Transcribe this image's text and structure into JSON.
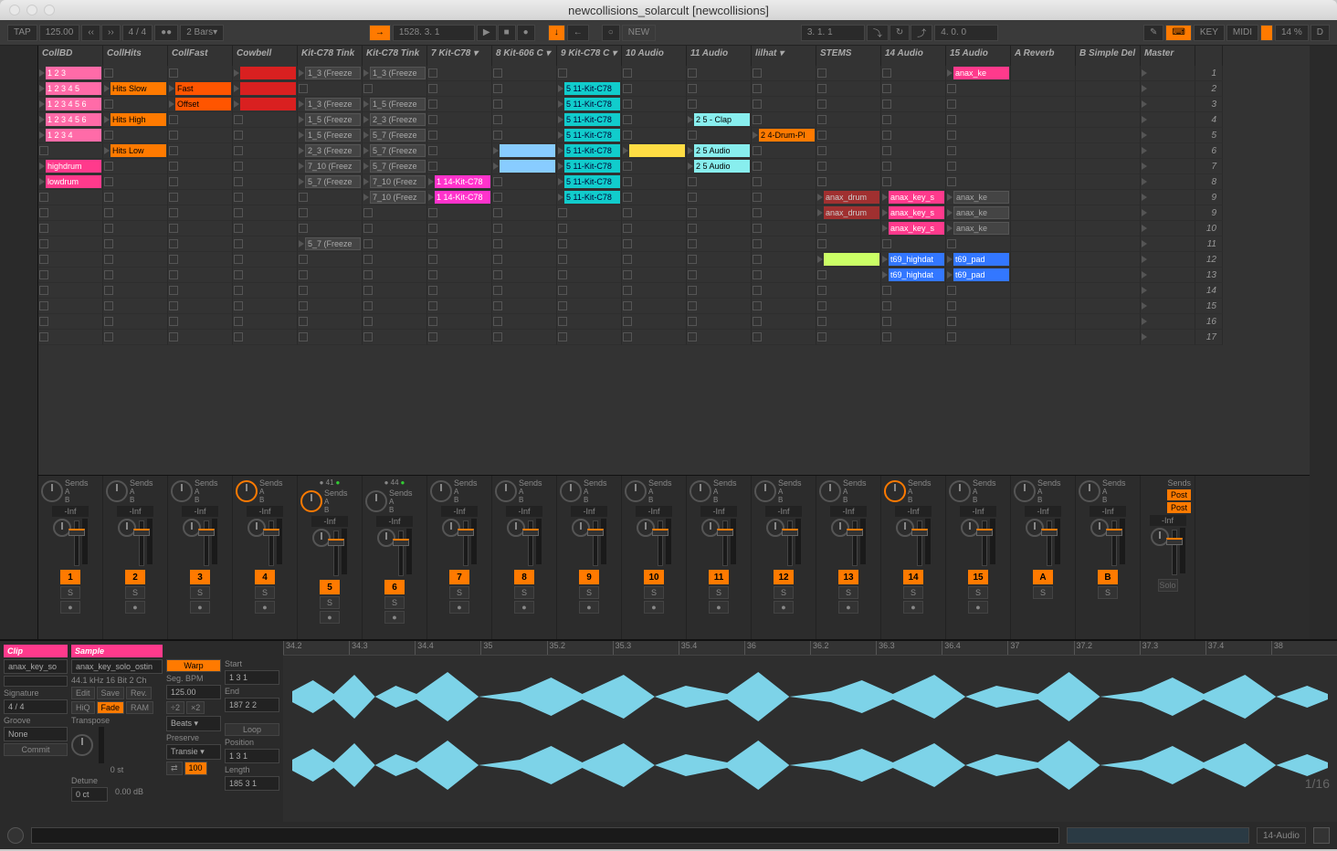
{
  "window": {
    "title": "newcollisions_solarcult  [newcollisions]"
  },
  "toolbar": {
    "tap": "TAP",
    "tempo": "125.00",
    "sig": "4 / 4",
    "quantize": "2 Bars",
    "position": "1528. 3. 1",
    "loop_pos": "3. 1. 1",
    "loop_len": "4. 0. 0",
    "key": "KEY",
    "midi": "MIDI",
    "cpu": "14 %",
    "d": "D",
    "new": "NEW"
  },
  "tracks": [
    "CollBD",
    "CollHits",
    "CollFast",
    "Cowbell",
    "Kit-C78 Tink",
    "Kit-C78 Tink",
    "7 Kit-C78",
    "8 Kit-606 C",
    "9 Kit-C78 C",
    "10 Audio",
    "11 Audio",
    "lilhat",
    "STEMS",
    "14 Audio",
    "15 Audio",
    "A Reverb",
    "B Simple Del",
    "Master"
  ],
  "scenes": [
    "1",
    "2",
    "3",
    "4",
    "5",
    "6",
    "7",
    "8",
    "9",
    "9",
    "10",
    "11",
    "12",
    "13",
    "14",
    "15",
    "16",
    "17"
  ],
  "grid": [
    [
      {
        "c": "c-pink",
        "t": "1 2 3"
      },
      {
        "c": "stop"
      },
      {
        "c": "stop"
      },
      {
        "c": "c-red",
        "t": ""
      },
      {
        "c": "c-grey",
        "t": "1_3 (Freeze"
      },
      {
        "c": "c-grey",
        "t": "1_3 (Freeze"
      },
      {
        "c": "stop"
      },
      {
        "c": "stop"
      },
      {
        "c": "stop"
      },
      {
        "c": "stop"
      },
      {
        "c": "stop"
      },
      {
        "c": "stop"
      },
      {
        "c": "stop"
      },
      {
        "c": "stop"
      },
      {
        "c": "c-dpink",
        "t": "anax_ke"
      },
      {
        "c": ""
      },
      {
        "c": ""
      }
    ],
    [
      {
        "c": "c-pink",
        "t": "1 2 3 4 5"
      },
      {
        "c": "c-orange",
        "t": "Hits Slow"
      },
      {
        "c": "c-dorange",
        "t": "Fast"
      },
      {
        "c": "c-red",
        "t": ""
      },
      {
        "c": "stop"
      },
      {
        "c": "stop"
      },
      {
        "c": "stop"
      },
      {
        "c": "stop"
      },
      {
        "c": "c-cyan",
        "t": "5 11-Kit-C78"
      },
      {
        "c": "stop"
      },
      {
        "c": "stop"
      },
      {
        "c": "stop"
      },
      {
        "c": "stop"
      },
      {
        "c": "stop"
      },
      {
        "c": "stop"
      },
      {
        "c": ""
      },
      {
        "c": ""
      }
    ],
    [
      {
        "c": "c-pink",
        "t": "1 2 3 4 5 6"
      },
      {
        "c": "stop"
      },
      {
        "c": "c-dorange",
        "t": "Offset"
      },
      {
        "c": "c-red",
        "t": ""
      },
      {
        "c": "c-grey",
        "t": "1_3 (Freeze"
      },
      {
        "c": "c-grey",
        "t": "1_5 (Freeze"
      },
      {
        "c": "stop"
      },
      {
        "c": "stop"
      },
      {
        "c": "c-cyan",
        "t": "5 11-Kit-C78"
      },
      {
        "c": "stop"
      },
      {
        "c": "stop"
      },
      {
        "c": "stop"
      },
      {
        "c": "stop"
      },
      {
        "c": "stop"
      },
      {
        "c": "stop"
      },
      {
        "c": ""
      },
      {
        "c": ""
      }
    ],
    [
      {
        "c": "c-pink",
        "t": "1 2 3 4 5 6"
      },
      {
        "c": "c-orange",
        "t": "Hits High"
      },
      {
        "c": "stop"
      },
      {
        "c": "stop"
      },
      {
        "c": "c-grey",
        "t": "1_5 (Freeze"
      },
      {
        "c": "c-grey",
        "t": "2_3 (Freeze"
      },
      {
        "c": "stop"
      },
      {
        "c": "stop"
      },
      {
        "c": "c-cyan",
        "t": "5 11-Kit-C78"
      },
      {
        "c": "stop"
      },
      {
        "c": "c-lcyan",
        "t": "2 5 - Clap"
      },
      {
        "c": "stop"
      },
      {
        "c": "stop"
      },
      {
        "c": "stop"
      },
      {
        "c": "stop"
      },
      {
        "c": ""
      },
      {
        "c": ""
      }
    ],
    [
      {
        "c": "c-pink",
        "t": "1 2 3 4"
      },
      {
        "c": "stop"
      },
      {
        "c": "stop"
      },
      {
        "c": "stop"
      },
      {
        "c": "c-grey",
        "t": "1_5 (Freeze"
      },
      {
        "c": "c-grey",
        "t": "5_7 (Freeze"
      },
      {
        "c": "stop"
      },
      {
        "c": "stop"
      },
      {
        "c": "c-cyan",
        "t": "5 11-Kit-C78"
      },
      {
        "c": "stop"
      },
      {
        "c": "stop"
      },
      {
        "c": "c-orange",
        "t": "2 4-Drum-Pl"
      },
      {
        "c": "stop"
      },
      {
        "c": "stop"
      },
      {
        "c": "stop"
      },
      {
        "c": ""
      },
      {
        "c": ""
      }
    ],
    [
      {
        "c": "stop"
      },
      {
        "c": "c-orange",
        "t": "Hits Low"
      },
      {
        "c": "stop"
      },
      {
        "c": "stop"
      },
      {
        "c": "c-grey",
        "t": "2_3 (Freeze"
      },
      {
        "c": "c-grey",
        "t": "5_7 (Freeze"
      },
      {
        "c": "stop"
      },
      {
        "c": "c-lblue",
        "t": ""
      },
      {
        "c": "c-cyan",
        "t": "5 11-Kit-C78"
      },
      {
        "c": "c-yellow",
        "t": ""
      },
      {
        "c": "c-lcyan",
        "t": "2 5 Audio"
      },
      {
        "c": "stop"
      },
      {
        "c": "stop"
      },
      {
        "c": "stop"
      },
      {
        "c": "stop"
      },
      {
        "c": ""
      },
      {
        "c": ""
      }
    ],
    [
      {
        "c": "c-dpink",
        "t": "highdrum"
      },
      {
        "c": "stop"
      },
      {
        "c": "stop"
      },
      {
        "c": "stop"
      },
      {
        "c": "c-grey",
        "t": "7_10 (Freez"
      },
      {
        "c": "c-grey",
        "t": "5_7 (Freeze"
      },
      {
        "c": "stop"
      },
      {
        "c": "c-lblue",
        "t": ""
      },
      {
        "c": "c-cyan",
        "t": "5 11-Kit-C78"
      },
      {
        "c": "stop"
      },
      {
        "c": "c-lcyan",
        "t": "2 5 Audio"
      },
      {
        "c": "stop"
      },
      {
        "c": "stop"
      },
      {
        "c": "stop"
      },
      {
        "c": "stop"
      },
      {
        "c": ""
      },
      {
        "c": ""
      }
    ],
    [
      {
        "c": "c-dpink",
        "t": "lowdrum"
      },
      {
        "c": "stop"
      },
      {
        "c": "stop"
      },
      {
        "c": "stop"
      },
      {
        "c": "c-grey",
        "t": "5_7 (Freeze"
      },
      {
        "c": "c-grey",
        "t": "7_10 (Freez"
      },
      {
        "c": "c-magenta",
        "t": "1 14-Kit-C78"
      },
      {
        "c": "stop"
      },
      {
        "c": "c-cyan",
        "t": "5 11-Kit-C78"
      },
      {
        "c": "stop"
      },
      {
        "c": "stop"
      },
      {
        "c": "stop"
      },
      {
        "c": "stop"
      },
      {
        "c": "stop"
      },
      {
        "c": "stop"
      },
      {
        "c": ""
      },
      {
        "c": ""
      }
    ],
    [
      {
        "c": "stop"
      },
      {
        "c": "stop"
      },
      {
        "c": "stop"
      },
      {
        "c": "stop"
      },
      {
        "c": "stop"
      },
      {
        "c": "c-grey",
        "t": "7_10 (Freez"
      },
      {
        "c": "c-magenta",
        "t": "1 14-Kit-C78"
      },
      {
        "c": "stop"
      },
      {
        "c": "c-cyan",
        "t": "5 11-Kit-C78"
      },
      {
        "c": "stop"
      },
      {
        "c": "stop"
      },
      {
        "c": "stop"
      },
      {
        "c": "c-dred",
        "t": "anax_drum"
      },
      {
        "c": "c-dpink",
        "t": "anax_key_s"
      },
      {
        "c": "c-grey",
        "t": "anax_ke"
      },
      {
        "c": ""
      },
      {
        "c": ""
      }
    ],
    [
      {
        "c": "stop"
      },
      {
        "c": "stop"
      },
      {
        "c": "stop"
      },
      {
        "c": "stop"
      },
      {
        "c": "stop"
      },
      {
        "c": "stop"
      },
      {
        "c": "stop"
      },
      {
        "c": "stop"
      },
      {
        "c": "stop"
      },
      {
        "c": "stop"
      },
      {
        "c": "stop"
      },
      {
        "c": "stop"
      },
      {
        "c": "c-dred",
        "t": "anax_drum"
      },
      {
        "c": "c-dpink",
        "t": "anax_key_s"
      },
      {
        "c": "c-grey",
        "t": "anax_ke"
      },
      {
        "c": ""
      },
      {
        "c": ""
      }
    ],
    [
      {
        "c": "stop"
      },
      {
        "c": "stop"
      },
      {
        "c": "stop"
      },
      {
        "c": "stop"
      },
      {
        "c": "stop"
      },
      {
        "c": "stop"
      },
      {
        "c": "stop"
      },
      {
        "c": "stop"
      },
      {
        "c": "stop"
      },
      {
        "c": "stop"
      },
      {
        "c": "stop"
      },
      {
        "c": "stop"
      },
      {
        "c": "stop"
      },
      {
        "c": "c-dpink",
        "t": "anax_key_s"
      },
      {
        "c": "c-grey",
        "t": "anax_ke"
      },
      {
        "c": ""
      },
      {
        "c": ""
      }
    ],
    [
      {
        "c": "stop"
      },
      {
        "c": "stop"
      },
      {
        "c": "stop"
      },
      {
        "c": "stop"
      },
      {
        "c": "c-grey",
        "t": "5_7 (Freeze"
      },
      {
        "c": "stop"
      },
      {
        "c": "stop"
      },
      {
        "c": "stop"
      },
      {
        "c": "stop"
      },
      {
        "c": "stop"
      },
      {
        "c": "stop"
      },
      {
        "c": "stop"
      },
      {
        "c": "stop"
      },
      {
        "c": "stop"
      },
      {
        "c": "stop"
      },
      {
        "c": ""
      },
      {
        "c": ""
      }
    ],
    [
      {
        "c": "stop"
      },
      {
        "c": "stop"
      },
      {
        "c": "stop"
      },
      {
        "c": "stop"
      },
      {
        "c": "stop"
      },
      {
        "c": "stop"
      },
      {
        "c": "stop"
      },
      {
        "c": "stop"
      },
      {
        "c": "stop"
      },
      {
        "c": "stop"
      },
      {
        "c": "stop"
      },
      {
        "c": "stop"
      },
      {
        "c": "c-ygreen",
        "t": ""
      },
      {
        "c": "c-blue",
        "t": "t69_highdat"
      },
      {
        "c": "c-blue",
        "t": "t69_pad"
      },
      {
        "c": ""
      },
      {
        "c": ""
      }
    ],
    [
      {
        "c": "stop"
      },
      {
        "c": "stop"
      },
      {
        "c": "stop"
      },
      {
        "c": "stop"
      },
      {
        "c": "stop"
      },
      {
        "c": "stop"
      },
      {
        "c": "stop"
      },
      {
        "c": "stop"
      },
      {
        "c": "stop"
      },
      {
        "c": "stop"
      },
      {
        "c": "stop"
      },
      {
        "c": "stop"
      },
      {
        "c": "stop"
      },
      {
        "c": "c-blue",
        "t": "t69_highdat"
      },
      {
        "c": "c-blue",
        "t": "t69_pad"
      },
      {
        "c": ""
      },
      {
        "c": ""
      }
    ],
    [
      {
        "c": "stop"
      },
      {
        "c": "stop"
      },
      {
        "c": "stop"
      },
      {
        "c": "stop"
      },
      {
        "c": "stop"
      },
      {
        "c": "stop"
      },
      {
        "c": "stop"
      },
      {
        "c": "stop"
      },
      {
        "c": "stop"
      },
      {
        "c": "stop"
      },
      {
        "c": "stop"
      },
      {
        "c": "stop"
      },
      {
        "c": "stop"
      },
      {
        "c": "stop"
      },
      {
        "c": "stop"
      },
      {
        "c": ""
      },
      {
        "c": ""
      }
    ],
    [
      {
        "c": "stop"
      },
      {
        "c": "stop"
      },
      {
        "c": "stop"
      },
      {
        "c": "stop"
      },
      {
        "c": "stop"
      },
      {
        "c": "stop"
      },
      {
        "c": "stop"
      },
      {
        "c": "stop"
      },
      {
        "c": "stop"
      },
      {
        "c": "stop"
      },
      {
        "c": "stop"
      },
      {
        "c": "stop"
      },
      {
        "c": "stop"
      },
      {
        "c": "stop"
      },
      {
        "c": "stop"
      },
      {
        "c": ""
      },
      {
        "c": ""
      }
    ],
    [
      {
        "c": "stop"
      },
      {
        "c": "stop"
      },
      {
        "c": "stop"
      },
      {
        "c": "stop"
      },
      {
        "c": "stop"
      },
      {
        "c": "stop"
      },
      {
        "c": "stop"
      },
      {
        "c": "stop"
      },
      {
        "c": "stop"
      },
      {
        "c": "stop"
      },
      {
        "c": "stop"
      },
      {
        "c": "stop"
      },
      {
        "c": "stop"
      },
      {
        "c": "stop"
      },
      {
        "c": "stop"
      },
      {
        "c": ""
      },
      {
        "c": ""
      }
    ],
    [
      {
        "c": "stop"
      },
      {
        "c": "stop"
      },
      {
        "c": "stop"
      },
      {
        "c": "stop"
      },
      {
        "c": "stop"
      },
      {
        "c": "stop"
      },
      {
        "c": "stop"
      },
      {
        "c": "stop"
      },
      {
        "c": "stop"
      },
      {
        "c": "stop"
      },
      {
        "c": "stop"
      },
      {
        "c": "stop"
      },
      {
        "c": "stop"
      },
      {
        "c": "stop"
      },
      {
        "c": "stop"
      },
      {
        "c": ""
      },
      {
        "c": ""
      }
    ]
  ],
  "mixer": {
    "sends_label": "Sends",
    "a": "A",
    "b": "B",
    "inf": "-Inf",
    "s": "S",
    "post": "Post",
    "solo": "Solo",
    "nums": [
      "1",
      "2",
      "3",
      "4",
      "5",
      "6",
      "7",
      "8",
      "9",
      "10",
      "11",
      "12",
      "13",
      "14",
      "15",
      "A",
      "B",
      ""
    ],
    "midi_ind": [
      {
        "t": 4,
        "v": "41"
      },
      {
        "t": 5,
        "v": "44"
      }
    ]
  },
  "clipview": {
    "clip_hdr": "Clip",
    "sample_hdr": "Sample",
    "name": "anax_key_so",
    "filename": "anax_key_solo_ostin",
    "format": "44.1 kHz 16 Bit 2 Ch",
    "sig_label": "Signature",
    "sig": "4 / 4",
    "groove_label": "Groove",
    "groove": "None",
    "commit": "Commit",
    "edit": "Edit",
    "save": "Save",
    "rev": "Rev.",
    "hiq": "HiQ",
    "fade": "Fade",
    "ram": "RAM",
    "transpose": "Transpose",
    "transpose_v": "0 st",
    "detune": "Detune",
    "detune_v": "0 ct",
    "gain": "0.00 dB",
    "warp": "Warp",
    "segbpm": "Seg. BPM",
    "bpm": "125.00",
    "warpmode": "Beats",
    "preserve": "Preserve",
    "transients": "Transie",
    "start": "Start",
    "start_v": "1  3  1",
    "end": "End",
    "end_v": "187  2  2",
    "loop": "Loop",
    "pos": "Position",
    "pos_v": "1  3  1",
    "len": "Length",
    "len_v": "185  3  1",
    "link": "100"
  },
  "ruler": [
    "34.2",
    "34.3",
    "34.4",
    "35",
    "35.2",
    "35.3",
    "35.4",
    "36",
    "36.2",
    "36.3",
    "36.4",
    "37",
    "37.2",
    "37.3",
    "37.4",
    "38"
  ],
  "page": "1/16",
  "bottom": {
    "track": "14-Audio"
  }
}
